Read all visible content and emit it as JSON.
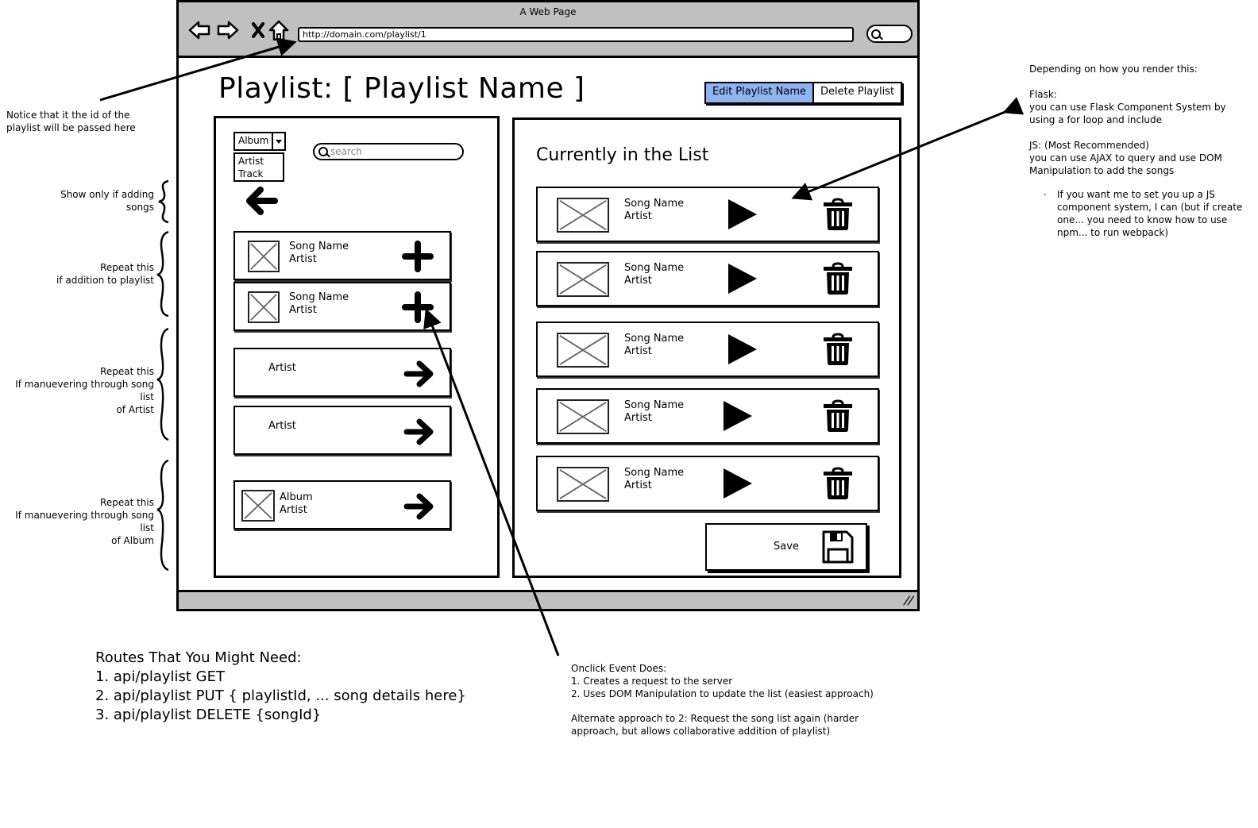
{
  "browser": {
    "window_title": "A Web Page",
    "url": "http://domain.com/playlist/1",
    "nav_icons": [
      "back-arrow-icon",
      "forward-arrow-icon",
      "stop-icon",
      "home-icon"
    ]
  },
  "page": {
    "title": "Playlist: [ Playlist Name ]",
    "actions": {
      "edit_label": "Edit Playlist Name",
      "delete_label": "Delete Playlist",
      "edit_color": "#8fb3f0"
    }
  },
  "left_panel": {
    "filter": {
      "selected": "Album",
      "options": [
        "Artist",
        "Track"
      ]
    },
    "search_placeholder": "search",
    "back_icon": "left-arrow-icon",
    "song_results": [
      {
        "song": "Song Name",
        "artist": "Artist",
        "action_icon": "plus-icon"
      },
      {
        "song": "Song Name",
        "artist": "Artist",
        "action_icon": "plus-icon"
      }
    ],
    "artist_results": [
      {
        "artist": "Artist",
        "action_icon": "right-arrow-icon"
      },
      {
        "artist": "Artist",
        "action_icon": "right-arrow-icon"
      }
    ],
    "album_results": [
      {
        "album": "Album",
        "artist": "Artist",
        "action_icon": "right-arrow-icon"
      }
    ]
  },
  "right_panel": {
    "title": "Currently in the List",
    "songs": [
      {
        "song": "Song Name",
        "artist": "Artist"
      },
      {
        "song": "Song Name",
        "artist": "Artist"
      },
      {
        "song": "Song Name",
        "artist": "Artist"
      },
      {
        "song": "Song Name",
        "artist": "Artist"
      },
      {
        "song": "Song Name",
        "artist": "Artist"
      }
    ],
    "save_label": "Save"
  },
  "annotations": {
    "url_note": [
      "Notice that it the id of the",
      "playlist will be passed here"
    ],
    "show_only": [
      "Show only if adding",
      "songs"
    ],
    "repeat_addition": [
      "Repeat this",
      "if addition to playlist"
    ],
    "repeat_artist": [
      "Repeat this",
      "If manuevering through song list",
      "of Artist"
    ],
    "repeat_album": [
      "Repeat this",
      "If manuevering through song list",
      "of Album"
    ],
    "render_note": {
      "heading": "Depending on how you render this:",
      "flask_title": "Flask:",
      "flask_lines": [
        "you can use Flask Component System by",
        "using a for loop and include"
      ],
      "js_title": "JS: (Most Recommended)",
      "js_lines": [
        "you can use AJAX to query and use DOM",
        "Manipulation to add the songs"
      ],
      "bullet_lines": [
        "If you want me to set you up a JS",
        "component system, I can (but if create",
        "one... you need to know how to use",
        "npm... to run webpack)"
      ]
    },
    "routes": {
      "heading": "Routes That You Might Need:",
      "items": [
        "1. api/playlist GET",
        "2. api/playlist PUT { playlistId, ... song details here}",
        "3. api/playlist DELETE {songId}"
      ]
    },
    "onclick": {
      "heading": "Onclick Event Does:",
      "items": [
        "1. Creates a request to the server",
        "2. Uses DOM Manipulation to update the list (easiest approach)"
      ],
      "alternate": [
        "Alternate approach to 2: Request the song list again (harder",
        "approach, but allows collaborative addition of playlist)"
      ]
    }
  }
}
